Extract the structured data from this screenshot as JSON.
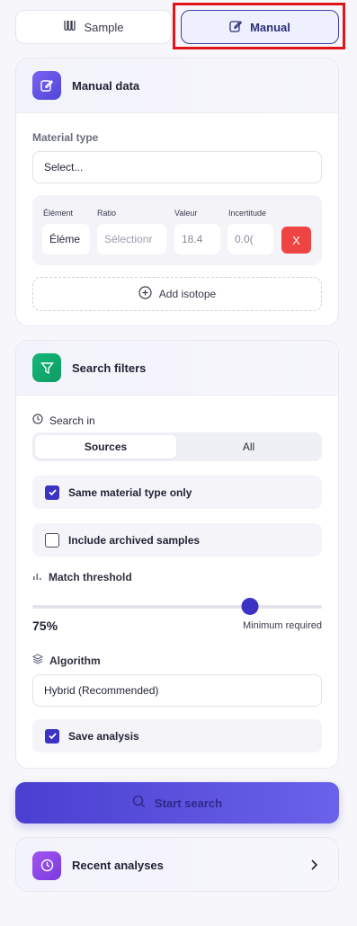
{
  "mode": {
    "sample_label": "Sample",
    "manual_label": "Manual"
  },
  "manual_card": {
    "title": "Manual data",
    "material_type_label": "Material type",
    "material_type_value": "Select...",
    "isotope_headers": {
      "element": "Élément",
      "ratio": "Ratio",
      "value": "Valeur",
      "uncertainty": "Incertitude"
    },
    "isotope_row": {
      "element_value": "Éléme",
      "ratio_placeholder": "Sélectionr",
      "value_value": "18.4",
      "uncertainty_value": "0.0(",
      "remove_label": "X"
    },
    "add_isotope_label": "Add isotope"
  },
  "filters_card": {
    "title": "Search filters",
    "search_in_label": "Search in",
    "search_in_options": [
      "Sources",
      "All"
    ],
    "same_material_label": "Same material type only",
    "include_archived_label": "Include archived samples",
    "threshold_label": "Match threshold",
    "threshold_value": 75,
    "threshold_display": "75%",
    "threshold_hint": "Minimum required",
    "algorithm_label": "Algorithm",
    "algorithm_value": "Hybrid (Recommended)",
    "save_analysis_label": "Save analysis",
    "checks": {
      "same_material": true,
      "include_archived": false,
      "save_analysis": true
    }
  },
  "start_search_label": "Start search",
  "recent_analyses_label": "Recent analyses",
  "colors": {
    "accent": "#3b33c4",
    "danger": "#ee4444",
    "success": "#14b87a",
    "highlight": "#e0151b"
  }
}
